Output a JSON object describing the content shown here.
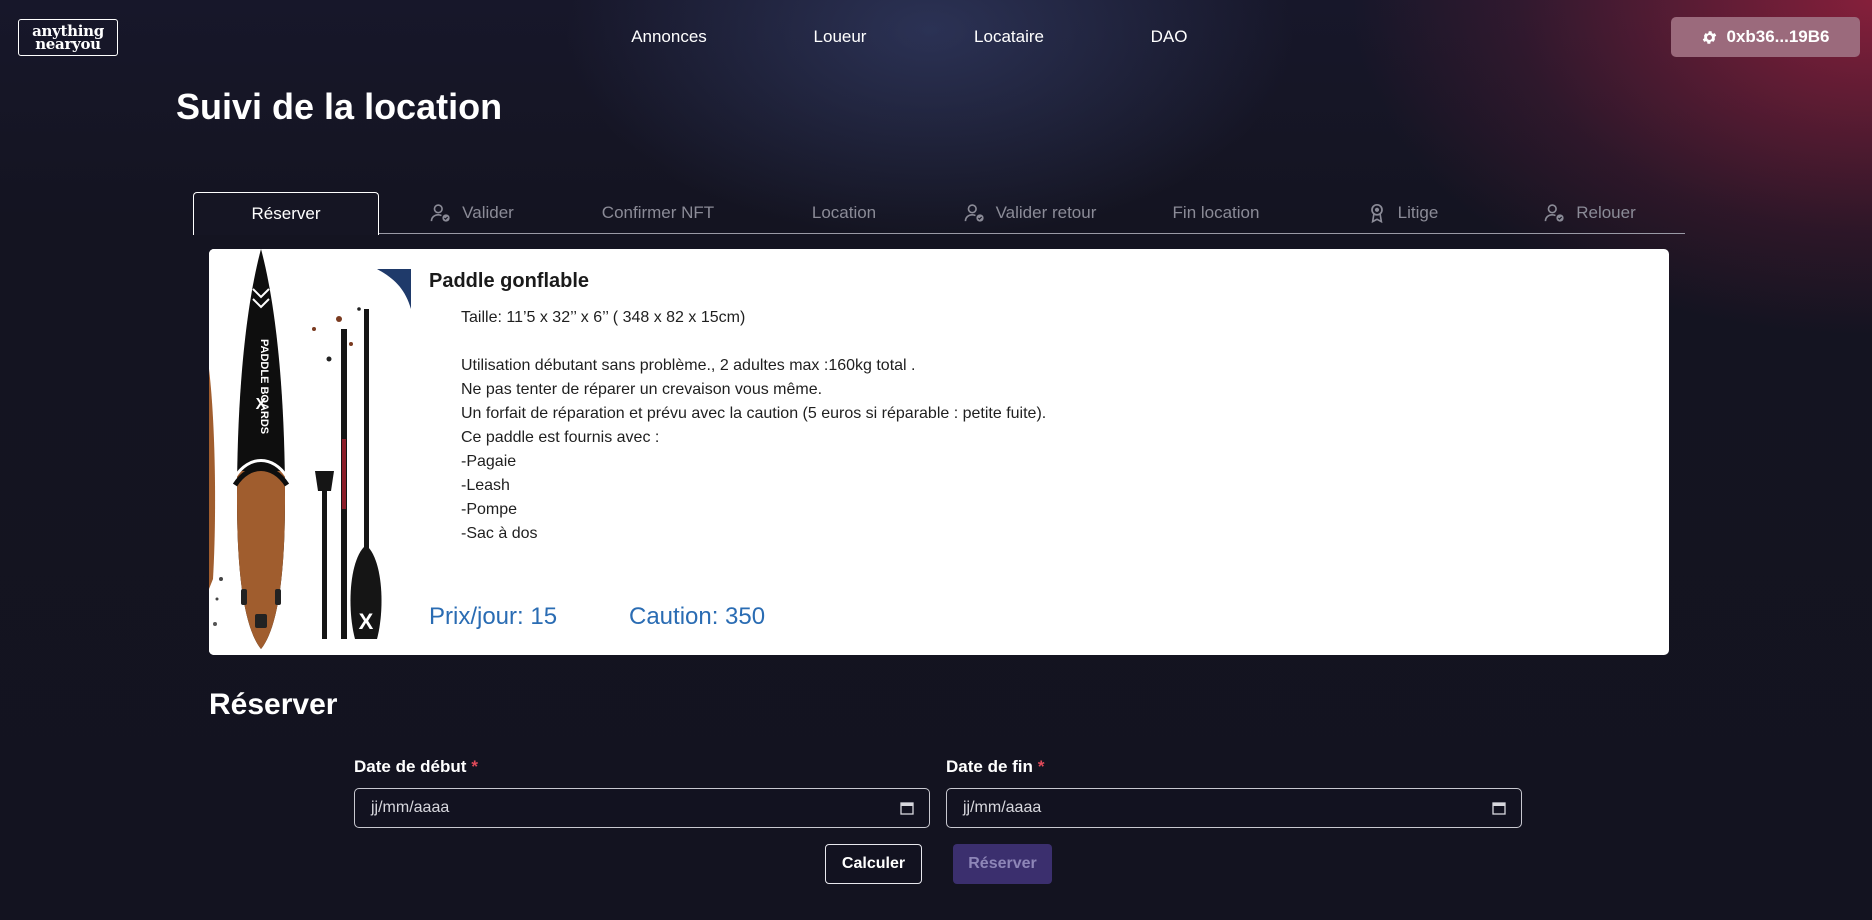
{
  "header": {
    "logo_text": "anything\nnearyou",
    "nav": [
      "Annonces",
      "Loueur",
      "Locataire",
      "DAO"
    ],
    "wallet": "0xb36...19B6"
  },
  "page_title": "Suivi de la location",
  "steps": [
    {
      "label": "Réserver",
      "icon": "none",
      "active": true
    },
    {
      "label": "Valider",
      "icon": "user-check-icon",
      "active": false
    },
    {
      "label": "Confirmer NFT",
      "icon": "none",
      "active": false
    },
    {
      "label": "Location",
      "icon": "none",
      "active": false
    },
    {
      "label": "Valider retour",
      "icon": "user-check-icon",
      "active": false
    },
    {
      "label": "Fin location",
      "icon": "none",
      "active": false
    },
    {
      "label": "Litige",
      "icon": "award-icon",
      "active": false
    },
    {
      "label": "Relouer",
      "icon": "user-check-icon",
      "active": false
    }
  ],
  "product": {
    "title": "Paddle gonflable",
    "description_lines": [
      "Taille: 11’5 x 32’’ x 6’’ ( 348 x 82 x 15cm)",
      "",
      "Utilisation débutant sans problème., 2 adultes max :160kg total .",
      "Ne pas tenter de réparer un crevaison vous même.",
      "Un forfait de réparation et prévu avec la caution (5 euros si réparable : petite fuite).",
      "Ce paddle est fournis avec :",
      "-Pagaie",
      "-Leash",
      "-Pompe",
      "-Sac à dos"
    ],
    "price": "Prix/jour: 15",
    "caution": "Caution: 350",
    "image_board_text": "PADDLE BOARDS",
    "accent_color": "#2a6cb3"
  },
  "reserve": {
    "title": "Réserver",
    "start_label": "Date de début",
    "end_label": "Date de fin",
    "required_mark": "*",
    "start_value": "jj/mm/aaaa",
    "end_value": "jj/mm/aaaa",
    "calc_button": "Calculer",
    "reserve_button": "Réserver"
  }
}
